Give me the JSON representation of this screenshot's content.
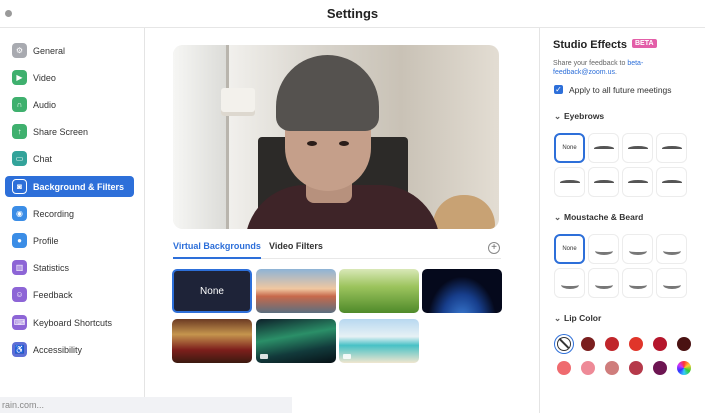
{
  "window": {
    "title": "Settings"
  },
  "sidebar": {
    "items": [
      {
        "label": "General",
        "icon": "gear-icon",
        "color": "#a8aab0"
      },
      {
        "label": "Video",
        "icon": "video-camera-icon",
        "color": "#3fb06e"
      },
      {
        "label": "Audio",
        "icon": "headphones-icon",
        "color": "#3fb06e"
      },
      {
        "label": "Share Screen",
        "icon": "share-screen-icon",
        "color": "#3fb06e"
      },
      {
        "label": "Chat",
        "icon": "chat-bubble-icon",
        "color": "#33a39a"
      },
      {
        "label": "Background & Filters",
        "icon": "person-background-icon",
        "color": "#2d6fd9",
        "active": true
      },
      {
        "label": "Recording",
        "icon": "record-icon",
        "color": "#3b8de6"
      },
      {
        "label": "Profile",
        "icon": "profile-icon",
        "color": "#3b8de6"
      },
      {
        "label": "Statistics",
        "icon": "statistics-icon",
        "color": "#8d65d6"
      },
      {
        "label": "Feedback",
        "icon": "smiley-icon",
        "color": "#8d65d6"
      },
      {
        "label": "Keyboard Shortcuts",
        "icon": "keyboard-icon",
        "color": "#8d65d6"
      },
      {
        "label": "Accessibility",
        "icon": "accessibility-icon",
        "color": "#5e6fd6"
      }
    ]
  },
  "main": {
    "tabs": [
      {
        "label": "Virtual Backgrounds",
        "active": true
      },
      {
        "label": "Video Filters",
        "active": false
      }
    ],
    "add_icon": "plus-circle-icon",
    "backgrounds": [
      {
        "label": "None",
        "selected": true,
        "icon": "none-tile"
      },
      {
        "icon": "golden-gate-bridge-image"
      },
      {
        "icon": "grass-image"
      },
      {
        "icon": "earth-from-space-image"
      },
      {
        "icon": "grand-hall-image"
      },
      {
        "icon": "aurora-image"
      },
      {
        "icon": "beach-palm-image"
      }
    ],
    "footer_hint": "rain.com..."
  },
  "studio": {
    "title": "Studio Effects",
    "badge": "BETA",
    "feedback_prefix": "Share your feedback to ",
    "feedback_link": "beta-feedback@zoom.us",
    "feedback_suffix": ".",
    "apply_all_label": "Apply to all future meetings",
    "apply_all_checked": true,
    "eyebrows": {
      "title": "Eyebrows",
      "none_label": "None",
      "selected_index": 0
    },
    "moustache": {
      "title": "Moustache & Beard",
      "none_label": "None",
      "selected_index": 0
    },
    "lip_color": {
      "title": "Lip Color",
      "selected_index": 0,
      "colors": [
        "#ffffff",
        "#7a1f1f",
        "#c0262b",
        "#e0352a",
        "#b5162c",
        "#4a1212",
        "#ef6b6f",
        "#ee8a97",
        "#cf7d7c",
        "#b5394a",
        "#6d1552",
        "rainbow"
      ]
    }
  }
}
